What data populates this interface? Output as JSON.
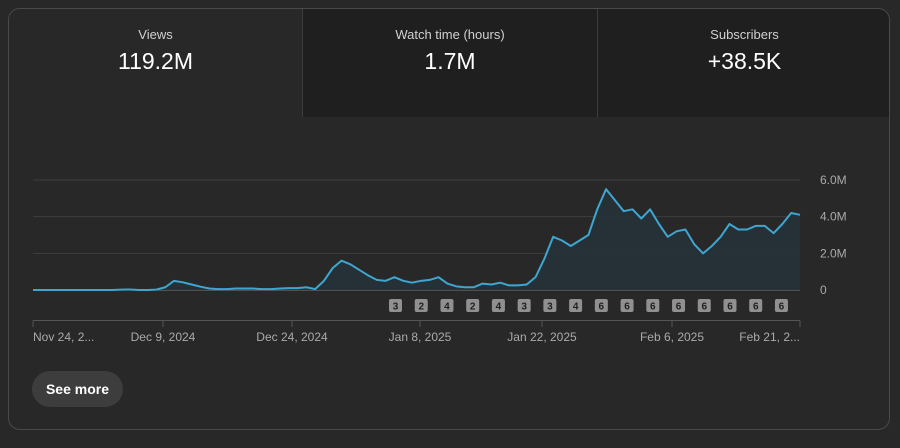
{
  "tabs": [
    {
      "label": "Views",
      "value": "119.2M"
    },
    {
      "label": "Watch time (hours)",
      "value": "1.7M"
    },
    {
      "label": "Subscribers",
      "value": "+38.5K"
    }
  ],
  "see_more_label": "See more",
  "colors": {
    "line": "#3ea6d0",
    "area": "#263238",
    "marker_bg": "#909090"
  },
  "chart_data": {
    "type": "area",
    "title": "",
    "xlabel": "",
    "ylabel": "",
    "x_tick_labels": [
      "Nov 24, 2...",
      "Dec 9, 2024",
      "Dec 24, 2024",
      "Jan 8, 2025",
      "Jan 22, 2025",
      "Feb 6, 2025",
      "Feb 21, 2..."
    ],
    "y_ticks": [
      {
        "value": 0,
        "label": "0"
      },
      {
        "value": 2000000,
        "label": "2.0M"
      },
      {
        "value": 4000000,
        "label": "4.0M"
      },
      {
        "value": 6000000,
        "label": "6.0M"
      }
    ],
    "ylim": [
      0,
      6000000
    ],
    "grid": true,
    "series": [
      {
        "values": [
          0,
          0,
          0,
          0,
          0,
          0,
          0,
          0,
          0,
          0,
          0.02,
          0.03,
          0,
          0,
          0.02,
          0.15,
          0.5,
          0.42,
          0.3,
          0.18,
          0.08,
          0.05,
          0.05,
          0.08,
          0.08,
          0.08,
          0.05,
          0.05,
          0.08,
          0.1,
          0.1,
          0.15,
          0.05,
          0.5,
          1.2,
          1.6,
          1.4,
          1.1,
          0.8,
          0.55,
          0.5,
          0.7,
          0.5,
          0.4,
          0.5,
          0.55,
          0.7,
          0.35,
          0.2,
          0.15,
          0.15,
          0.35,
          0.3,
          0.4,
          0.25,
          0.25,
          0.3,
          0.7,
          1.7,
          2.9,
          2.7,
          2.4,
          2.7,
          3.0,
          4.4,
          5.5,
          4.9,
          4.3,
          4.4,
          3.9,
          4.4,
          3.6,
          2.9,
          3.2,
          3.3,
          2.5,
          2.0,
          2.4,
          2.9,
          3.6,
          3.3,
          3.3,
          3.5,
          3.5,
          3.1,
          3.6,
          4.2,
          4.1
        ]
      }
    ],
    "markers": [
      "3",
      "2",
      "4",
      "2",
      "4",
      "3",
      "3",
      "4",
      "6",
      "6",
      "6",
      "6",
      "6",
      "6",
      "6",
      "6"
    ]
  }
}
